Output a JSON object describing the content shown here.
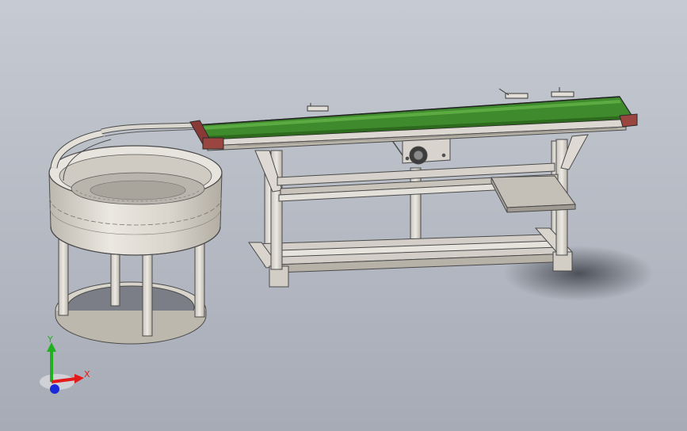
{
  "viewport": {
    "background_top": "#c6cad2",
    "background_bottom": "#a6abb6"
  },
  "model": {
    "belt_color": "#3f8a2c",
    "frame_color": "#d6d2ce",
    "bowl_color": "#dcd8cf",
    "end_cap_color": "#8a3a36"
  },
  "triad": {
    "x_label": "X",
    "y_label": "Y",
    "x_color": "#e21a1a",
    "y_color": "#20b020",
    "z_color": "#1a2ad8"
  }
}
